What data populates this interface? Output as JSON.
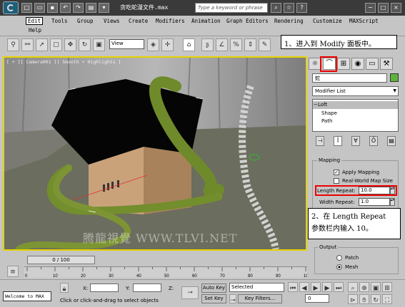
{
  "title_bar": {
    "window_title": "贪吃蛇漫文件.max",
    "search_placeholder": "Type a keyword or phrase"
  },
  "menu": {
    "items": [
      "Edit",
      "Tools",
      "Group",
      "Views",
      "Create",
      "Modifiers",
      "Animation",
      "Graph Editors",
      "Rendering",
      "Customize",
      "MAXScript",
      "Help"
    ]
  },
  "toolbar": {
    "view_dropdown": "View"
  },
  "callout1": {
    "text": "1、进入到 Modify 面板中。"
  },
  "callout2": {
    "line1": "2、在 Length Repeat",
    "line2": "参数栏内输入 10。"
  },
  "viewport": {
    "label": "[ + ][ Camera001 ][ Smooth + Highlights ]",
    "watermark": "腾龍視覺 WWW.TLVI.NET"
  },
  "command_panel": {
    "object_name": "蛇",
    "object_color": "#5db43b",
    "modifier_list": "Modifier List",
    "stack": [
      "Loft",
      "Shape",
      "Path"
    ],
    "mapping": {
      "group_label": "Mapping",
      "apply_mapping_label": "Apply Mapping",
      "apply_mapping_checked": true,
      "real_world_label": "Real-World Map Size",
      "real_world_checked": false,
      "length_repeat_label": "Length Repeat:",
      "length_repeat_value": "10.0",
      "width_repeat_label": "Width Repeat:",
      "width_repeat_value": "1.0"
    },
    "output": {
      "group_label": "Output",
      "patch_label": "Patch",
      "mesh_label": "Mesh",
      "selected": "Mesh"
    }
  },
  "timeline": {
    "slider_label": "0 / 100",
    "ticks": [
      "0",
      "10",
      "20",
      "30",
      "40",
      "50",
      "60",
      "70",
      "80",
      "90",
      "100"
    ]
  },
  "status": {
    "welcome": "Welcome to MAX",
    "prompt": "Click or click-and-drag to select objects",
    "x_label": "X:",
    "y_label": "Y:",
    "z_label": "Z:",
    "auto_key": "Auto Key",
    "set_key": "Set Key",
    "selected": "Selected",
    "key_filters": "Key Filters...",
    "frame": "0"
  },
  "colors": {
    "accent_highlight": "#e00000",
    "viewport_border": "#e6d300"
  }
}
